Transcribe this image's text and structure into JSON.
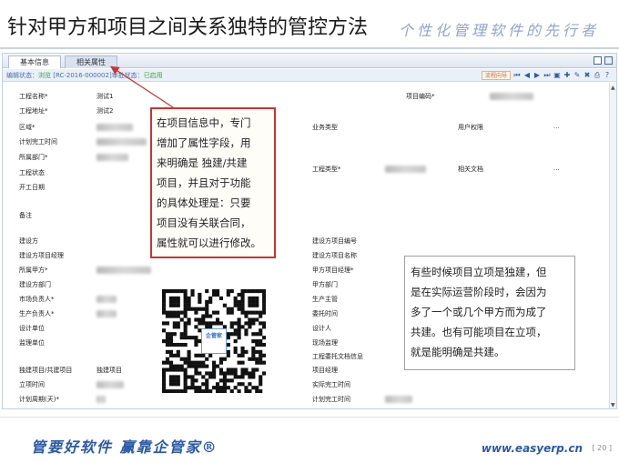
{
  "slide": {
    "title": "针对甲方和项目之间关系独特的管控方法",
    "slogan": "个性化管理软件的先行者"
  },
  "app": {
    "tabs": [
      "基本信息",
      "相关属性"
    ],
    "status": {
      "prefix": "编辑状态：",
      "edit_state": "浏览",
      "record": "[RC-2016-000002]",
      "approve_prefix": "审批状态：",
      "approve_state": "已启用"
    },
    "toolbar": {
      "flow_label": "流程向导"
    }
  },
  "form": {
    "left_fields": [
      {
        "label": "工程名称*",
        "value": "测试1"
      },
      {
        "label": "工程地址*",
        "value": "测试2"
      },
      {
        "label": "区域*",
        "value": ""
      },
      {
        "label": "计划完工时间",
        "value": ""
      },
      {
        "label": "所属部门*",
        "value": ""
      },
      {
        "label": "工程状态",
        "value": ""
      },
      {
        "label": "开工日期",
        "value": ""
      },
      {
        "label": "备注",
        "value": ""
      },
      {
        "label": "建设方",
        "value": ""
      },
      {
        "label": "建设方项目经理",
        "value": ""
      },
      {
        "label": "所属甲方*",
        "value": ""
      },
      {
        "label": "建设方部门",
        "value": ""
      },
      {
        "label": "市场负责人*",
        "value": ""
      },
      {
        "label": "生产负责人*",
        "value": ""
      },
      {
        "label": "设计单位",
        "value": ""
      },
      {
        "label": "监理单位",
        "value": ""
      },
      {
        "label": "独建项目/共建项目",
        "value": "独建项目"
      },
      {
        "label": "立项时间",
        "value": ""
      },
      {
        "label": "计划周期(天)*",
        "value": ""
      }
    ],
    "right_fields": [
      {
        "label": "项目编码*"
      },
      {
        "label": "业务类型"
      },
      {
        "label": "用户权限"
      },
      {
        "label": "工程类型*"
      },
      {
        "label": "相关文档"
      },
      {
        "label": "建设方项目编号"
      },
      {
        "label": "建设方项目名称"
      },
      {
        "label": "甲方项目经理*"
      },
      {
        "label": "甲方部门"
      },
      {
        "label": "生产主管"
      },
      {
        "label": "委托时间"
      },
      {
        "label": "设计人"
      },
      {
        "label": "现场监理"
      },
      {
        "label": "工程委托文档信息"
      },
      {
        "label": "项目经理"
      },
      {
        "label": "实际完工时间"
      },
      {
        "label": "计划完工时间"
      }
    ],
    "ellipsis": "..."
  },
  "callouts": {
    "note1": [
      "在项目信息中，专门",
      "增加了属性字段，用",
      "来明确是 独建/共建",
      "项目，并且对于功能",
      "的具体处理是：只要",
      "项目没有关联合同，",
      "属性就可以进行修改。"
    ],
    "note2": [
      "有些时候项目立项是独建，但",
      "是在实际运营阶段时，会因为",
      "多了一个或几个甲方而为成了",
      "共建。也有可能项目在立项，",
      "就是能明确是共建。"
    ]
  },
  "qr": {
    "center_label": "企管家"
  },
  "footer": {
    "slogan": "管要好软件 赢靠企管家®",
    "url": "www.easyerp.cn",
    "page": "[ 20 ]"
  }
}
